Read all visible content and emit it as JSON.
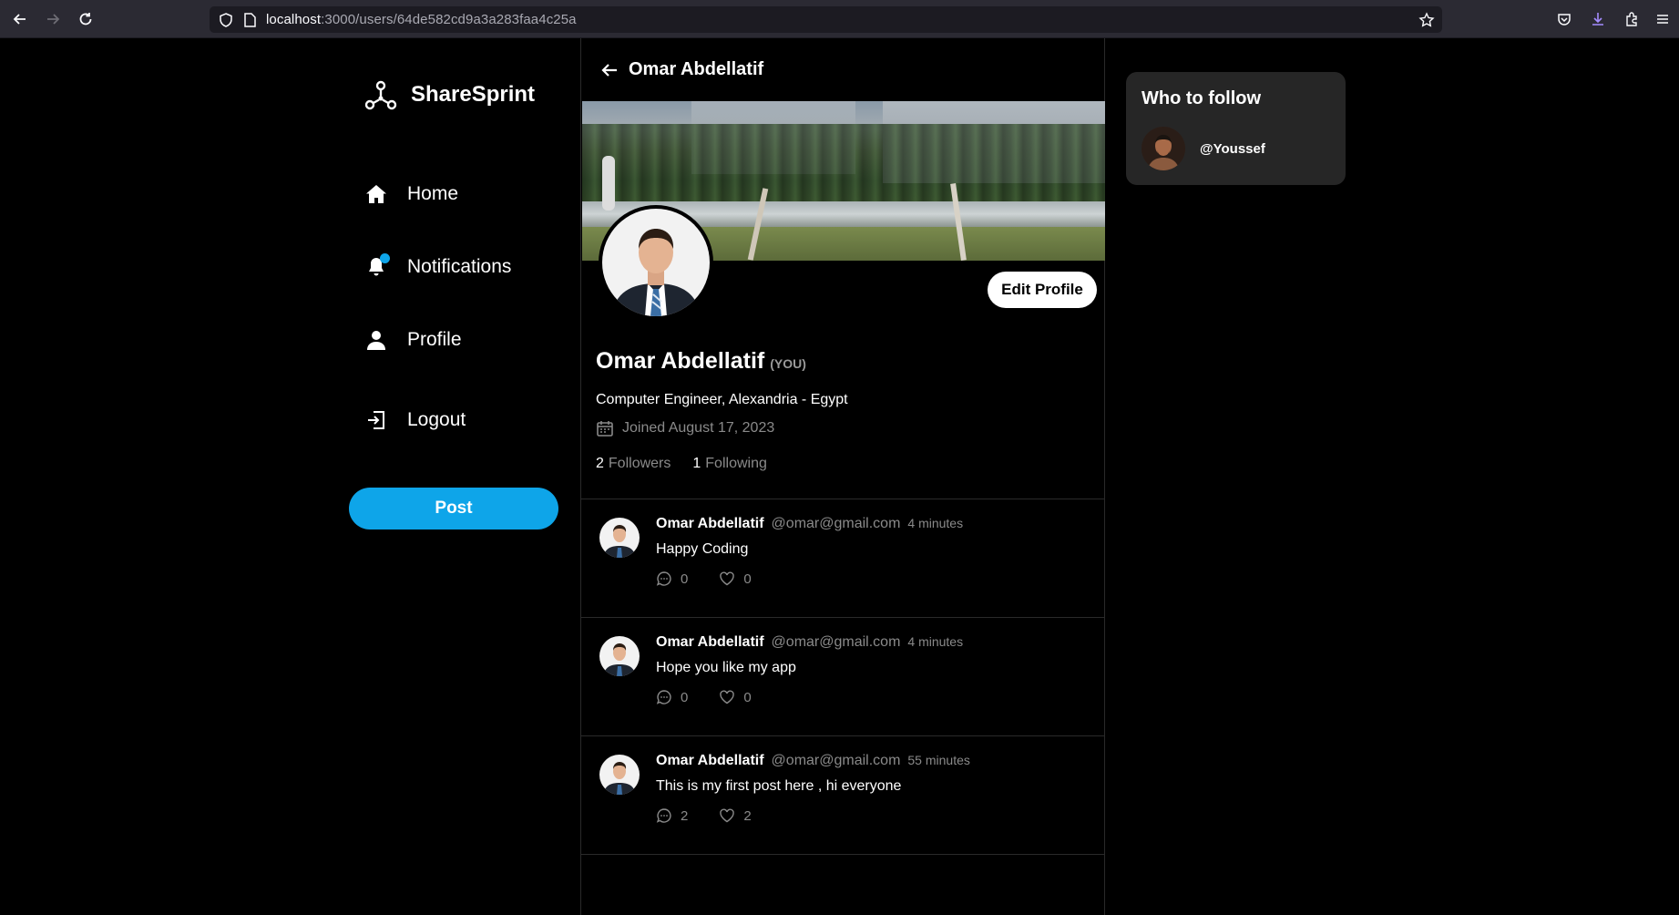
{
  "browser": {
    "url_host": "localhost",
    "url_path": ":3000/users/64de582cd9a3a283faa4c25a"
  },
  "sidebar": {
    "brand": "ShareSprint",
    "items": [
      {
        "label": "Home",
        "icon": "home-icon"
      },
      {
        "label": "Notifications",
        "icon": "bell-icon"
      },
      {
        "label": "Profile",
        "icon": "user-icon"
      },
      {
        "label": "Logout",
        "icon": "logout-icon"
      }
    ],
    "post_button": "Post"
  },
  "profile": {
    "header_name": "Omar Abdellatif",
    "name": "Omar Abdellatif",
    "you_tag": "(YOU)",
    "bio": "Computer Engineer, Alexandria - Egypt",
    "joined": "Joined August 17, 2023",
    "followers_count": "2",
    "followers_label": "Followers",
    "following_count": "1",
    "following_label": "Following",
    "edit_button": "Edit Profile"
  },
  "posts": [
    {
      "author": "Omar Abdellatif",
      "email": "@omar@gmail.com",
      "time": "4 minutes",
      "body": "Happy Coding",
      "comments": "0",
      "likes": "0"
    },
    {
      "author": "Omar Abdellatif",
      "email": "@omar@gmail.com",
      "time": "4 minutes",
      "body": "Hope you like my app",
      "comments": "0",
      "likes": "0"
    },
    {
      "author": "Omar Abdellatif",
      "email": "@omar@gmail.com",
      "time": "55 minutes",
      "body": "This is my first post here , hi everyone",
      "comments": "2",
      "likes": "2"
    }
  ],
  "who_to_follow": {
    "title": "Who to follow",
    "users": [
      {
        "handle": "@Youssef"
      }
    ]
  },
  "colors": {
    "accent": "#0ea5e9",
    "background": "#000000",
    "card": "#262626",
    "muted": "#8a8a8a"
  }
}
